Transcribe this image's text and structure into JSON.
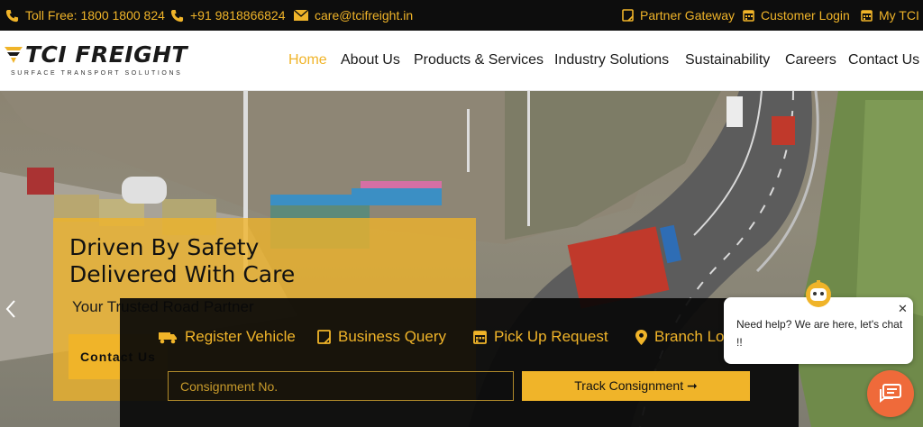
{
  "topbar": {
    "toll_free": "Toll Free: 1800 1800 824",
    "phone": "+91 9818866824",
    "email": "care@tcifreight.in",
    "partner_gateway": "Partner Gateway",
    "customer_login": "Customer Login",
    "my_tci": "My TCI"
  },
  "brand": {
    "name": "TCI FREIGHT",
    "tagline": "SURFACE TRANSPORT SOLUTIONS"
  },
  "nav": {
    "items": [
      "Home",
      "About Us",
      "Products & Services",
      "Industry Solutions",
      "Sustainability",
      "Careers",
      "Contact Us"
    ],
    "active": "Home"
  },
  "hero": {
    "title_line1": "Driven By Safety",
    "title_line2": "Delivered With Care",
    "subtitle": "Your Trusted Road Partner",
    "cta": "Contact Us"
  },
  "track": {
    "tabs": [
      "Register Vehicle",
      "Business Query",
      "Pick Up Request",
      "Branch Lo"
    ],
    "input_placeholder": "Consignment No.",
    "button": "Track Consignment ➞"
  },
  "chat": {
    "message": "Need help? We are here, let's chat !!",
    "close": "✕"
  },
  "colors": {
    "accent": "#f0b429",
    "topbar_bg": "#0d0d0d",
    "chat_launcher": "#ef6a3a"
  },
  "icons": [
    "phone-icon",
    "mobile-icon",
    "mail-icon",
    "gateway-icon",
    "calendar-icon",
    "truck-icon",
    "note-icon",
    "location-icon",
    "chevron-left-icon",
    "chat-icon",
    "bot-icon"
  ]
}
